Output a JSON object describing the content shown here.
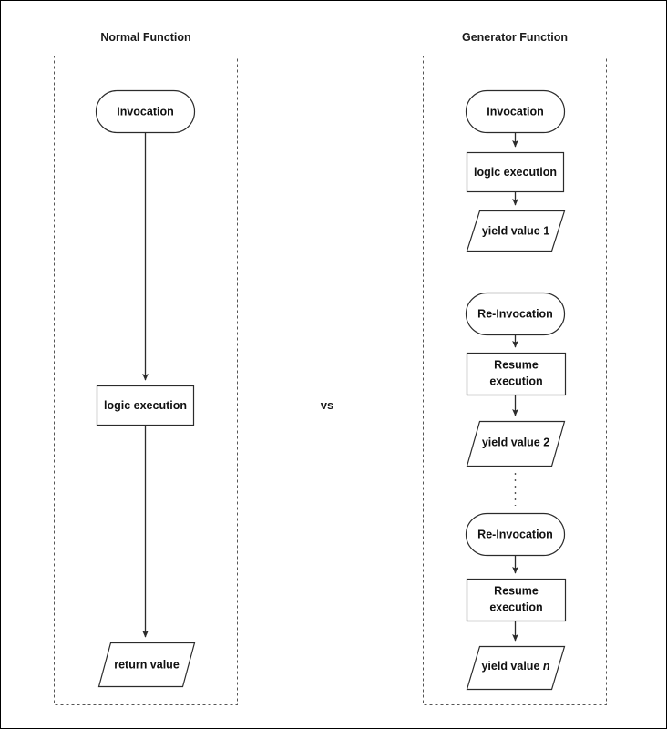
{
  "figure": {
    "type": "flowchart-comparison",
    "separator_label": "vs",
    "columns": [
      {
        "id": "normal-function",
        "title": "Normal Function",
        "nodes": [
          {
            "id": "n-invocation",
            "label": "Invocation",
            "shape": "stadium"
          },
          {
            "id": "n-logic",
            "label": "logic execution",
            "shape": "rectangle"
          },
          {
            "id": "n-return",
            "label": "return value",
            "shape": "parallelogram"
          }
        ],
        "edges": [
          {
            "from": "n-invocation",
            "to": "n-logic",
            "style": "arrow"
          },
          {
            "from": "n-logic",
            "to": "n-return",
            "style": "arrow"
          }
        ]
      },
      {
        "id": "generator-function",
        "title": "Generator Function",
        "nodes": [
          {
            "id": "g-invocation",
            "label": "Invocation",
            "shape": "stadium"
          },
          {
            "id": "g-logic",
            "label": "logic execution",
            "shape": "rectangle"
          },
          {
            "id": "g-yield1",
            "label": "yield value 1",
            "shape": "parallelogram"
          },
          {
            "id": "g-reinvoke1",
            "label": "Re-Invocation",
            "shape": "stadium"
          },
          {
            "id": "g-resume1",
            "label": "Resume execution",
            "shape": "rectangle",
            "line1": "Resume",
            "line2": "execution"
          },
          {
            "id": "g-yield2",
            "label": "yield value 2",
            "shape": "parallelogram"
          },
          {
            "id": "g-reinvoke2",
            "label": "Re-Invocation",
            "shape": "stadium"
          },
          {
            "id": "g-resume2",
            "label": "Resume execution",
            "shape": "rectangle",
            "line1": "Resume",
            "line2": "execution"
          },
          {
            "id": "g-yieldn",
            "label": "yield value n",
            "shape": "parallelogram",
            "prefix": "yield value ",
            "italic_suffix": "n"
          }
        ],
        "edges": [
          {
            "from": "g-invocation",
            "to": "g-logic",
            "style": "arrow"
          },
          {
            "from": "g-logic",
            "to": "g-yield1",
            "style": "arrow"
          },
          {
            "from": "g-reinvoke1",
            "to": "g-resume1",
            "style": "arrow"
          },
          {
            "from": "g-resume1",
            "to": "g-yield2",
            "style": "arrow"
          },
          {
            "from": "g-yield2",
            "to": "g-reinvoke2",
            "style": "dotted-ellipsis"
          },
          {
            "from": "g-reinvoke2",
            "to": "g-resume2",
            "style": "arrow"
          },
          {
            "from": "g-resume2",
            "to": "g-yieldn",
            "style": "arrow"
          }
        ]
      }
    ],
    "colors": {
      "background": "#ffffff",
      "shape_stroke": "#2b2b2b",
      "group_stroke": "#555555",
      "text": "#101010",
      "border": "#000000"
    }
  }
}
